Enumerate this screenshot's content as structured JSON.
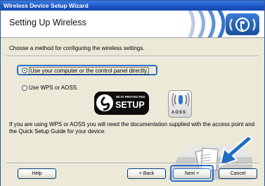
{
  "window": {
    "title": "Wireless Device Setup Wizard"
  },
  "header": {
    "title": "Setting Up Wireless"
  },
  "content": {
    "instruction": "Choose a method for configuring the wireless settings.",
    "options": [
      {
        "label": "Use your computer or the control panel directly.",
        "selected": true
      },
      {
        "label": "Use WPS or AOSS.",
        "selected": false
      }
    ],
    "logos": {
      "wps_small": "Wi-Fi PROTECTED",
      "wps_big": "SETUP",
      "aoss": "AOSS"
    },
    "note": "If you are using WPS or AOSS you will need the documentation supplied with the access point and the Quick Setup Guide for your device."
  },
  "buttons": {
    "help": "Help",
    "back": "< Back",
    "next": "Next >",
    "cancel": "Cancel"
  },
  "colors": {
    "titlebar": "#1a54c4",
    "highlight": "#2a6fc9",
    "arrow": "#1f6cc4"
  }
}
